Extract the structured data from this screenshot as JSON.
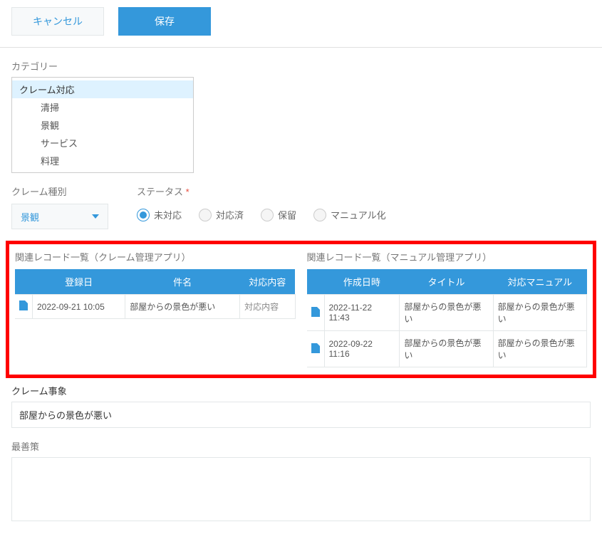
{
  "toolbar": {
    "cancel_label": "キャンセル",
    "save_label": "保存"
  },
  "category": {
    "label": "カテゴリー",
    "items": [
      {
        "label": "クレーム対応",
        "selected": true,
        "child": false
      },
      {
        "label": "清掃",
        "selected": false,
        "child": true
      },
      {
        "label": "景観",
        "selected": false,
        "child": true
      },
      {
        "label": "サービス",
        "selected": false,
        "child": true
      },
      {
        "label": "料理",
        "selected": false,
        "child": true
      }
    ]
  },
  "claim_type": {
    "label": "クレーム種別",
    "value": "景観"
  },
  "status": {
    "label": "ステータス",
    "required": "*",
    "options": [
      {
        "label": "未対応",
        "selected": true
      },
      {
        "label": "対応済",
        "selected": false
      },
      {
        "label": "保留",
        "selected": false
      },
      {
        "label": "マニュアル化",
        "selected": false
      }
    ]
  },
  "related_tables": {
    "claim_app": {
      "title": "関連レコード一覧（クレーム管理アプリ）",
      "headers": [
        "登録日",
        "件名",
        "対応内容"
      ],
      "rows": [
        {
          "date": "2022-09-21 10:05",
          "subject": "部屋からの景色が悪い",
          "action": "対応内容"
        }
      ]
    },
    "manual_app": {
      "title": "関連レコード一覧（マニュアル管理アプリ）",
      "headers": [
        "作成日時",
        "タイトル",
        "対応マニュアル"
      ],
      "rows": [
        {
          "date": "2022-11-22 11:43",
          "title": "部屋からの景色が悪い",
          "manual": "部屋からの景色が悪い"
        },
        {
          "date": "2022-09-22 11:16",
          "title": "部屋からの景色が悪い",
          "manual": "部屋からの景色が悪い"
        }
      ]
    }
  },
  "claim_detail": {
    "label": "クレーム事象",
    "value": "部屋からの景色が悪い"
  },
  "improvement": {
    "label": "最善策",
    "value": ""
  }
}
